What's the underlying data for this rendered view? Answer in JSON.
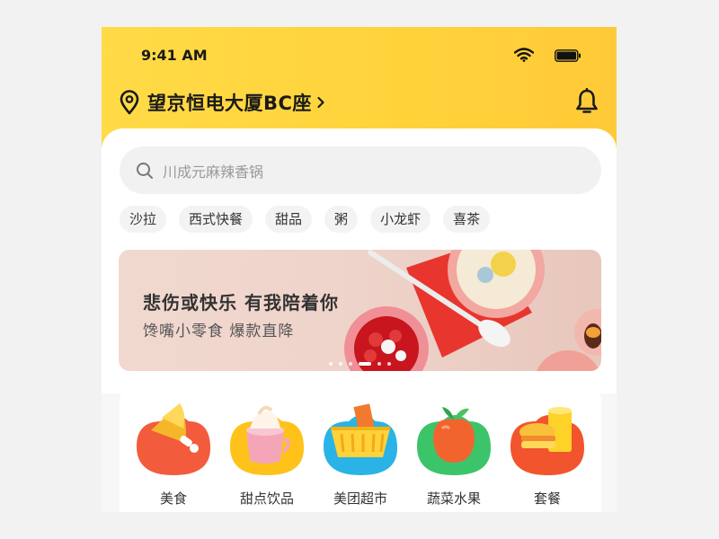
{
  "status_bar": {
    "time": "9:41 AM"
  },
  "header": {
    "location": "望京恒电大厦BC座"
  },
  "search": {
    "placeholder": "川成元麻辣香锅"
  },
  "chips": [
    "沙拉",
    "西式快餐",
    "甜品",
    "粥",
    "小龙虾",
    "喜茶"
  ],
  "banner": {
    "title": "悲伤或快乐 有我陪着你",
    "subtitle": "馋嘴小零食 爆款直降",
    "active_dot": 3,
    "dot_count": 6
  },
  "categories": [
    {
      "label": "美食",
      "icon": "food-icon",
      "color": "#f25b3c"
    },
    {
      "label": "甜点饮品",
      "icon": "dessert-drink-icon",
      "color": "#ffc21a"
    },
    {
      "label": "美团超市",
      "icon": "supermarket-basket-icon",
      "color": "#2ab3e6"
    },
    {
      "label": "蔬菜水果",
      "icon": "fruit-vegetable-icon",
      "color": "#3cc46b"
    },
    {
      "label": "套餐",
      "icon": "combo-meal-icon",
      "color": "#f2542e"
    }
  ],
  "colors": {
    "header_yellow": "#ffd23a",
    "text_dark": "#1a1a1a"
  }
}
